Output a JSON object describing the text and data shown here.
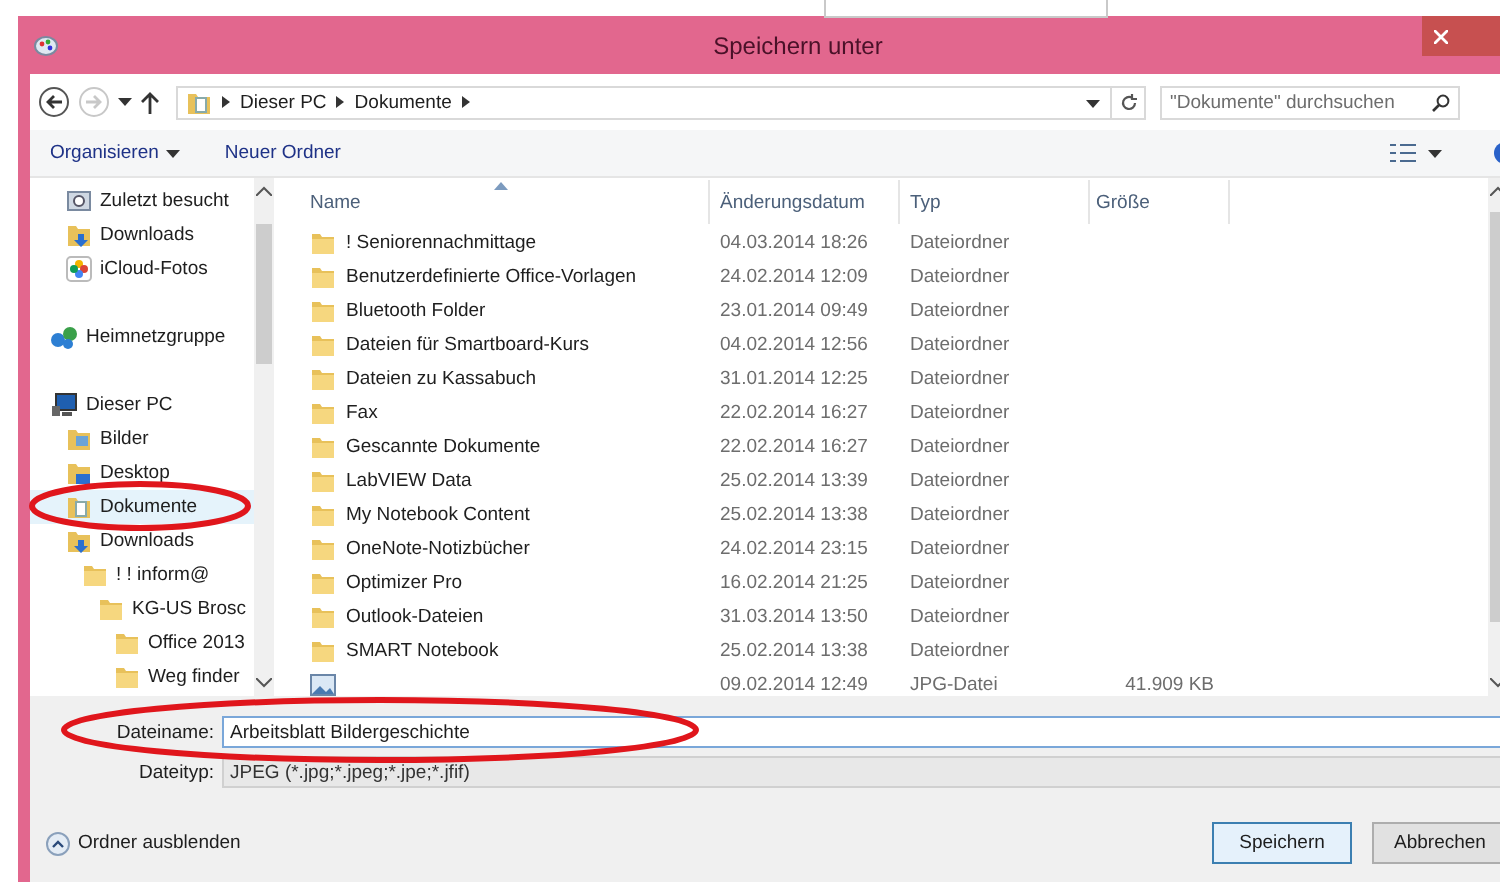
{
  "window": {
    "title": "Speichern unter"
  },
  "address": {
    "segments": [
      "Dieser PC",
      "Dokumente"
    ],
    "search_placeholder": "\"Dokumente\" durchsuchen",
    "forward_disabled": true
  },
  "toolbar": {
    "organize": "Organisieren",
    "new_folder": "Neuer Ordner"
  },
  "nav": {
    "favorites": [
      {
        "label": "Zuletzt besucht",
        "kind": "recent",
        "selected": false
      },
      {
        "label": "Downloads",
        "kind": "download",
        "selected": false
      },
      {
        "label": "iCloud-Fotos",
        "kind": "photos",
        "selected": false
      }
    ],
    "groups": [
      {
        "label": "Heimnetzgruppe",
        "kind": "network",
        "selected": false
      },
      {
        "label": "Dieser PC",
        "kind": "pc",
        "selected": false,
        "children": [
          {
            "label": "Bilder",
            "kind": "pictures",
            "selected": false
          },
          {
            "label": "Desktop",
            "kind": "desktop",
            "selected": false
          },
          {
            "label": "Dokumente",
            "kind": "documents",
            "selected": true
          },
          {
            "label": "Downloads",
            "kind": "download",
            "selected": false,
            "children": [
              {
                "label": "! ! inform@",
                "kind": "folder",
                "selected": false,
                "children": [
                  {
                    "label": "KG-US Brosc",
                    "kind": "folder",
                    "selected": false,
                    "children": [
                      {
                        "label": "Office 2013",
                        "kind": "folder",
                        "selected": false
                      },
                      {
                        "label": "Weg finder",
                        "kind": "folder",
                        "selected": false
                      }
                    ]
                  }
                ]
              }
            ]
          }
        ]
      }
    ]
  },
  "table": {
    "columns": [
      "Name",
      "Änderungsdatum",
      "Typ",
      "Größe"
    ],
    "rows": [
      {
        "kind": "folder",
        "name": "! Seniorennachmittage",
        "date": "04.03.2014 18:26",
        "type": "Dateiordner"
      },
      {
        "kind": "folder",
        "name": "Benutzerdefinierte Office-Vorlagen",
        "date": "24.02.2014 12:09",
        "type": "Dateiordner"
      },
      {
        "kind": "folder",
        "name": "Bluetooth Folder",
        "date": "23.01.2014 09:49",
        "type": "Dateiordner"
      },
      {
        "kind": "folder",
        "name": "Dateien für Smartboard-Kurs",
        "date": "04.02.2014 12:56",
        "type": "Dateiordner"
      },
      {
        "kind": "folder",
        "name": "Dateien zu Kassabuch",
        "date": "31.01.2014 12:25",
        "type": "Dateiordner"
      },
      {
        "kind": "folder",
        "name": "Fax",
        "date": "22.02.2014 16:27",
        "type": "Dateiordner"
      },
      {
        "kind": "folder",
        "name": "Gescannte Dokumente",
        "date": "22.02.2014 16:27",
        "type": "Dateiordner"
      },
      {
        "kind": "folder",
        "name": "LabVIEW Data",
        "date": "25.02.2014 13:39",
        "type": "Dateiordner"
      },
      {
        "kind": "folder",
        "name": "My Notebook Content",
        "date": "25.02.2014 13:38",
        "type": "Dateiordner"
      },
      {
        "kind": "folder",
        "name": "OneNote-Notizbücher",
        "date": "24.02.2014 23:15",
        "type": "Dateiordner"
      },
      {
        "kind": "folder",
        "name": "Optimizer Pro",
        "date": "16.02.2014 21:25",
        "type": "Dateiordner"
      },
      {
        "kind": "folder",
        "name": "Outlook-Dateien",
        "date": "31.03.2014 13:50",
        "type": "Dateiordner"
      },
      {
        "kind": "folder",
        "name": "SMART Notebook",
        "date": "25.02.2014 13:38",
        "type": "Dateiordner"
      },
      {
        "kind": "image",
        "date": "09.02.2014 12:49",
        "type": "JPG-Datei",
        "size": "41.909 KB"
      }
    ]
  },
  "form": {
    "filename_label": "Dateiname:",
    "filename": "Arbeitsblatt Bildergeschichte",
    "filetype_label": "Dateityp:",
    "filetype": "JPEG (*.jpg;*.jpeg;*.jpe;*.jfif)"
  },
  "footer": {
    "hide_folders": "Ordner ausblenden",
    "save": "Speichern",
    "cancel": "Abbrechen"
  }
}
